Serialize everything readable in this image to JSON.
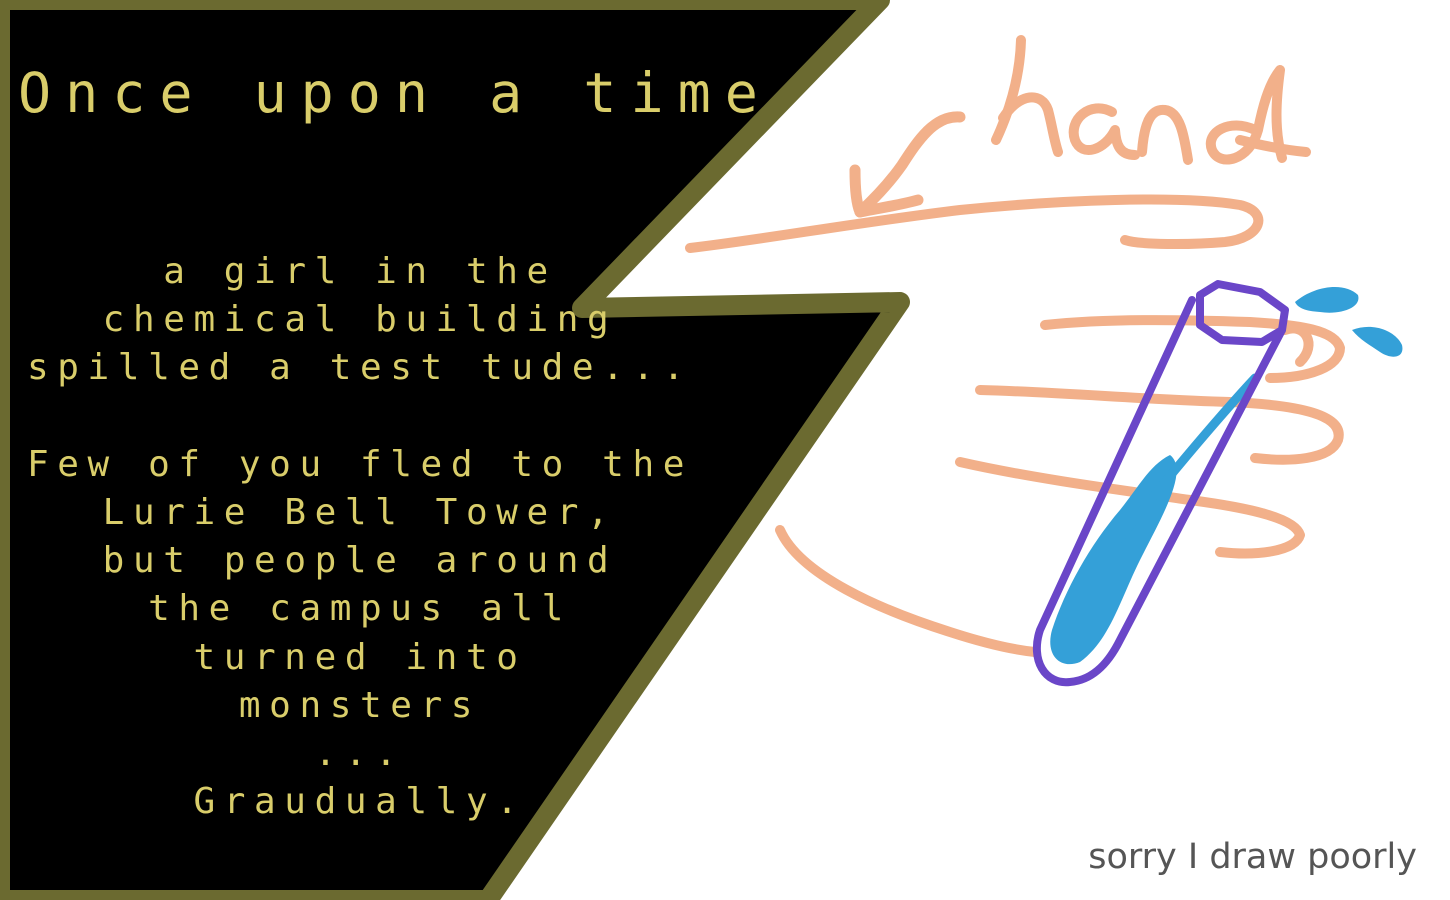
{
  "title": "Once upon a time",
  "story_lines": [
    "a girl in the",
    "chemical building",
    "spilled a test tude...",
    "",
    "Few of you fled to the",
    "Lurie Bell Tower,",
    "but people around",
    "the campus all",
    "turned into",
    "monsters",
    "...",
    "Graudually."
  ],
  "drawing_label": "hand",
  "footer_note": "sorry I draw poorly",
  "colors": {
    "panel": "#000000",
    "panel_border": "#6b6a30",
    "text": "#d9cd6a",
    "hand": "#f2b08a",
    "tube": "#6a46c8",
    "liquid": "#34a0d8",
    "footer": "#555555",
    "background": "#ffffff"
  },
  "icons": {
    "arrow": "arrow-left-icon",
    "hand": "hand-drawing",
    "tube": "test-tube-icon"
  }
}
